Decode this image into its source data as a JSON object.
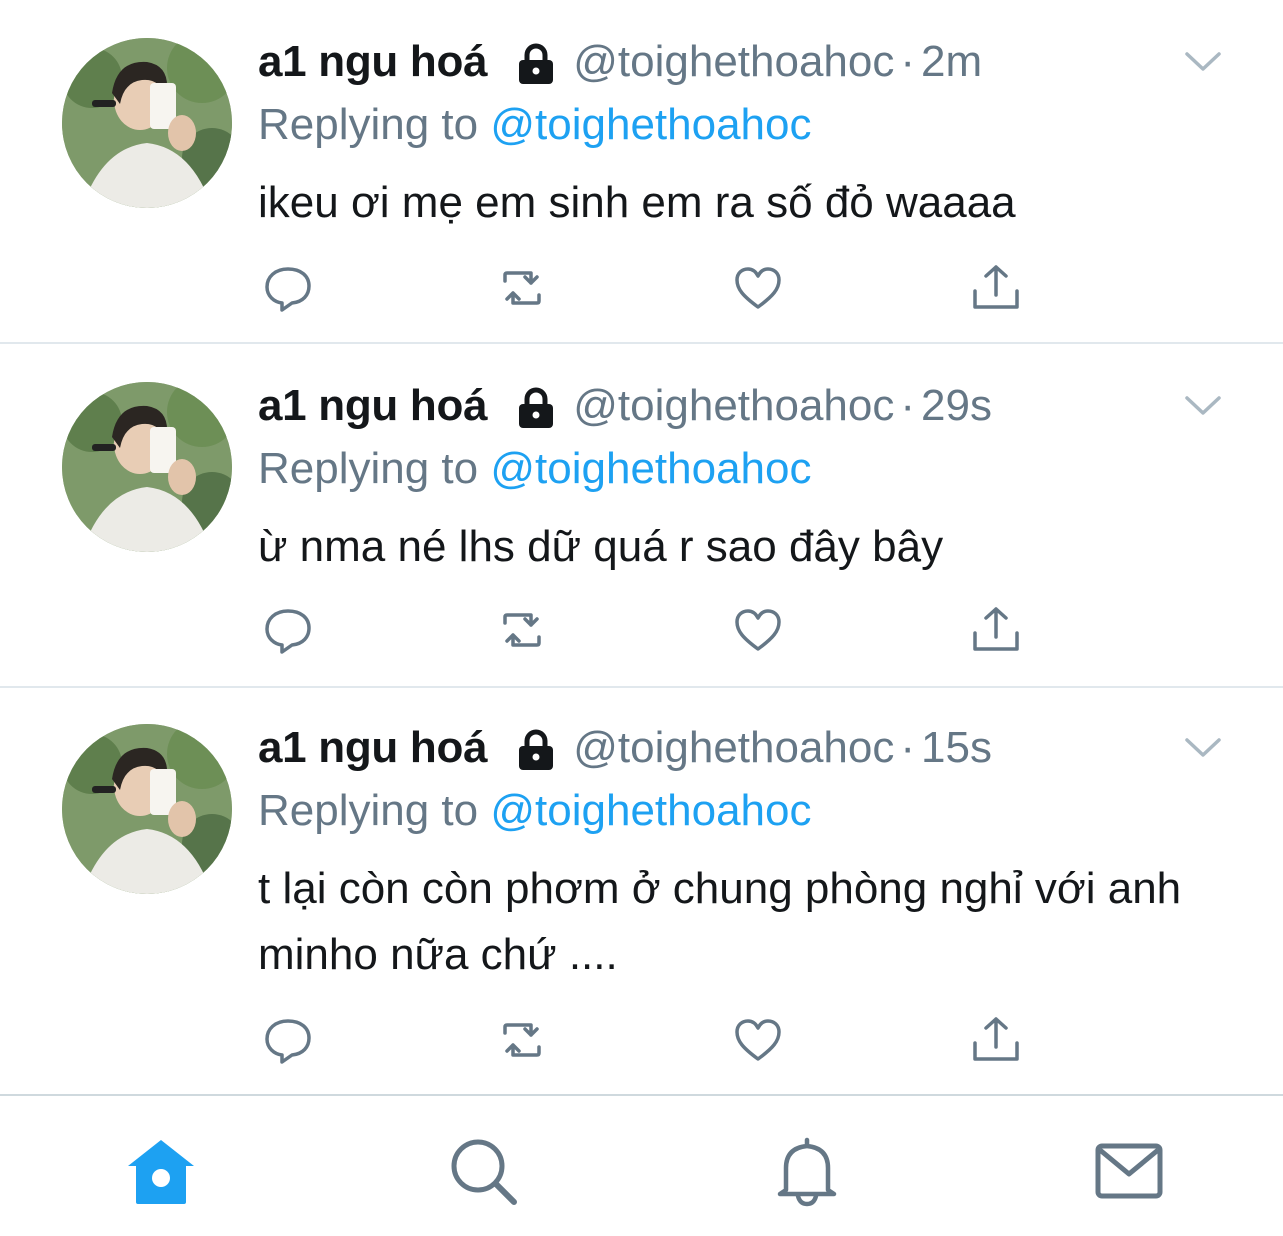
{
  "colors": {
    "accent": "#1da1f2",
    "secondary_text": "#657786",
    "primary_text": "#14171a",
    "divider": "#e1e8ed",
    "icon": "#657786"
  },
  "tweets": [
    {
      "display_name": "a1 ngu hoá",
      "handle": "@toighethoahoc",
      "separator": "·",
      "time": "2m",
      "replying_prefix": "Replying to",
      "replying_to": "@toighethoahoc",
      "text": "ikeu ơi mẹ em sinh em ra số đỏ waaaa"
    },
    {
      "display_name": "a1 ngu hoá",
      "handle": "@toighethoahoc",
      "separator": "·",
      "time": "29s",
      "replying_prefix": "Replying to",
      "replying_to": "@toighethoahoc",
      "text": "ừ nma né lhs dữ quá r sao đây bây"
    },
    {
      "display_name": "a1 ngu hoá",
      "handle": "@toighethoahoc",
      "separator": "·",
      "time": "15s",
      "replying_prefix": "Replying to",
      "replying_to": "@toighethoahoc",
      "text": "t lại còn còn phơm ở chung phòng nghỉ với anh minho nữa chứ ...."
    }
  ],
  "icons": {
    "lock": "lock-icon",
    "caret": "chevron-down-icon",
    "reply": "reply-icon",
    "retweet": "retweet-icon",
    "like": "heart-icon",
    "share": "share-icon",
    "home": "home-icon",
    "search": "search-icon",
    "notifications": "bell-icon",
    "messages": "mail-icon"
  },
  "tabbar": {
    "active_tab": "home"
  }
}
